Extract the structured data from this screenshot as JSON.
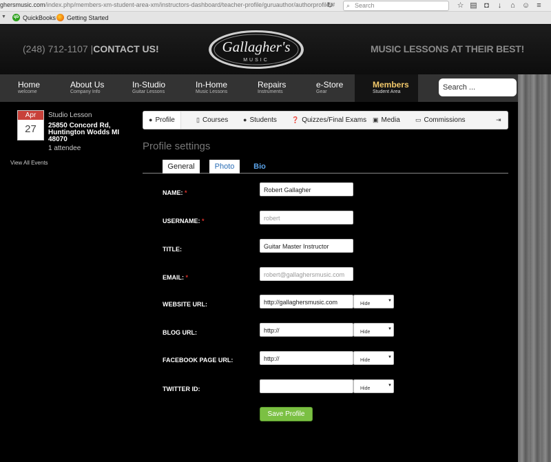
{
  "browser": {
    "url_host": "ghersmusic.com",
    "url_path": "/index.php/members-xm-student-area-xm/instructors-dashboard/teacher-profile/guruauthor/authorprofile/#",
    "search_placeholder": "Search",
    "bookmarks": [
      "QuickBooks",
      "Getting Started"
    ]
  },
  "header": {
    "phone": "(248) 712-1107 |",
    "contact": "CONTACT US!",
    "tagline": "MUSIC LESSONS AT THEIR BEST!",
    "logo_main": "Gallagher's",
    "logo_sub": "MUSIC"
  },
  "nav": {
    "items": [
      {
        "title": "Home",
        "sub": "welcome"
      },
      {
        "title": "About Us",
        "sub": "Company Info"
      },
      {
        "title": "In-Studio",
        "sub": "Guitar Lessons"
      },
      {
        "title": "In-Home",
        "sub": "Music Lessons"
      },
      {
        "title": "Repairs",
        "sub": "Instruments"
      },
      {
        "title": "e-Store",
        "sub": "Gear"
      },
      {
        "title": "Members",
        "sub": "Student Area"
      }
    ],
    "search_placeholder": "Search ..."
  },
  "event": {
    "month": "Apr",
    "day": "27",
    "type": "Studio Lesson",
    "address": "25850 Concord Rd, Huntington Wodds MI 48070",
    "attendees": "1 attendee",
    "view_all": "View All Events"
  },
  "profile_tabs": [
    "Profile",
    "Courses",
    "Students",
    "Quizzes/Final Exams",
    "Media",
    "Commissions"
  ],
  "page_title": "Profile settings",
  "sub_tabs": [
    "General",
    "Photo",
    "Bio"
  ],
  "form": {
    "name_label": "NAME:",
    "name_value": "Robert Gallagher",
    "username_label": "USERNAME:",
    "username_value": "robert",
    "title_label": "TITLE:",
    "title_value": "Guitar Master Instructor",
    "email_label": "EMAIL:",
    "email_value": "robert@gallaghersmusic.com",
    "website_label": "WEBSITE URL:",
    "website_value": "http://gallaghersmusic.com",
    "blog_label": "BLOG URL:",
    "blog_value": "http://",
    "facebook_label": "FACEBOOK PAGE URL:",
    "facebook_value": "http://",
    "twitter_label": "TWITTER ID:",
    "twitter_value": "",
    "visibility_option": "Hide",
    "required_mark": "*",
    "save_label": "Save Profile"
  },
  "colors": {
    "required": "#d9312b",
    "save": "#7bc043",
    "members_active": "#f2c86a"
  }
}
